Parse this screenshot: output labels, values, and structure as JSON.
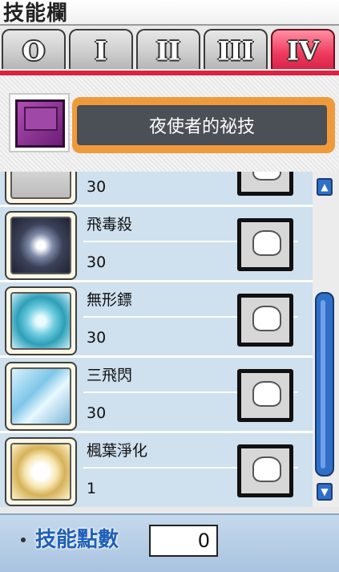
{
  "window": {
    "title": "技能欄"
  },
  "tabs": [
    {
      "label": "O",
      "active": false
    },
    {
      "label": "I",
      "active": false
    },
    {
      "label": "II",
      "active": false
    },
    {
      "label": "III",
      "active": false
    },
    {
      "label": "IV",
      "active": true
    }
  ],
  "book": {
    "icon": "purple-skill-book-icon",
    "title": "夜使者的祕技"
  },
  "skills": [
    {
      "name": "",
      "level": "30",
      "icon": "skill-icon-partial"
    },
    {
      "name": "飛毒殺",
      "level": "30",
      "icon": "shuriken-poison-skill-icon"
    },
    {
      "name": "無形鏢",
      "level": "30",
      "icon": "shadow-star-skill-icon"
    },
    {
      "name": "三飛閃",
      "level": "30",
      "icon": "triple-throw-skill-icon"
    },
    {
      "name": "楓葉淨化",
      "level": "1",
      "icon": "maple-cleanse-skill-icon"
    }
  ],
  "footer": {
    "label": "技能點數",
    "value": "0"
  },
  "colors": {
    "active_tab": "#ef3a5c",
    "accent": "#d9233f",
    "list_bg": "#cfe0ee",
    "scrollbar": "#2f6fc8"
  }
}
